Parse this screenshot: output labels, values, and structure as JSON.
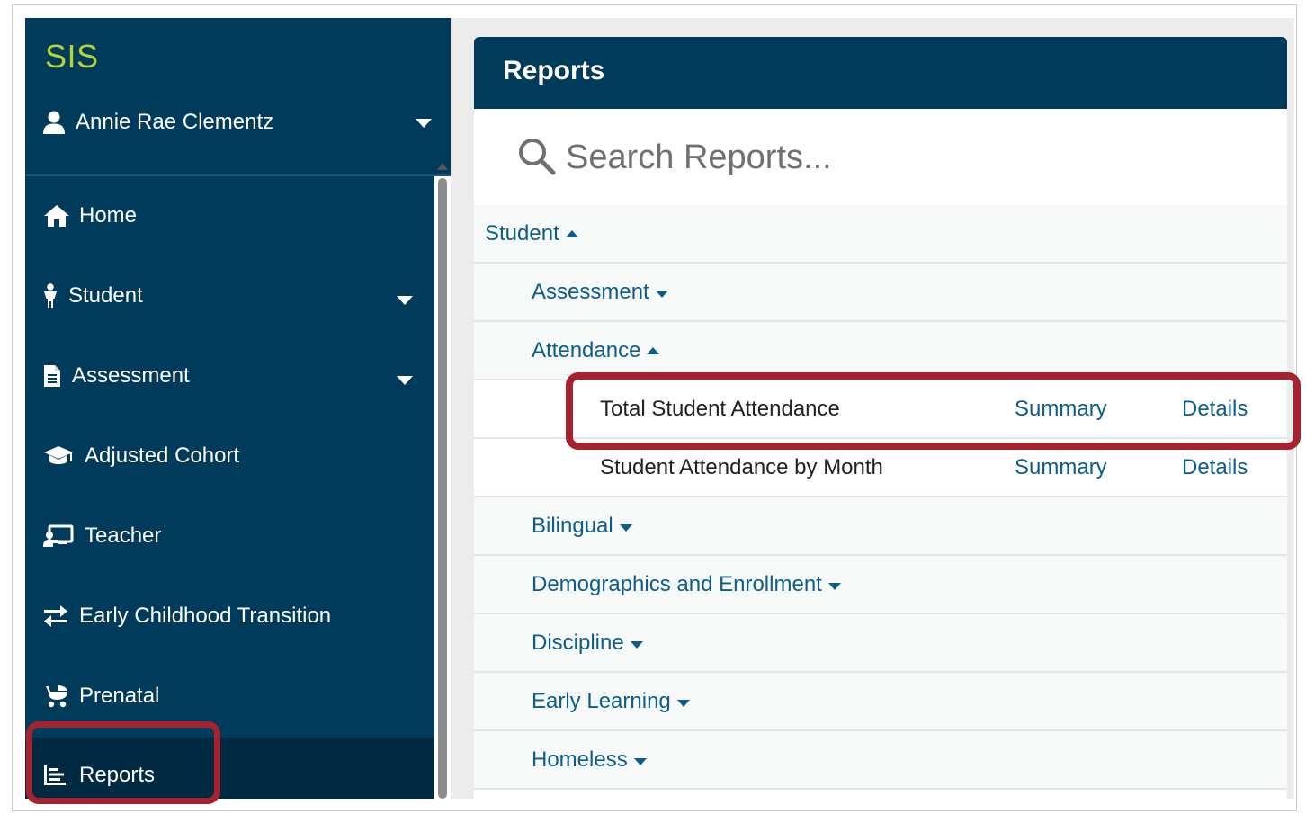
{
  "sidebar": {
    "brand": "SIS",
    "user": {
      "name": "Annie Rae Clementz",
      "icon": "user-icon"
    },
    "items": [
      {
        "label": "Home",
        "icon": "home-icon",
        "has_dropdown": false
      },
      {
        "label": "Student",
        "icon": "child-icon",
        "has_dropdown": true
      },
      {
        "label": "Assessment",
        "icon": "document-icon",
        "has_dropdown": true
      },
      {
        "label": "Adjusted Cohort",
        "icon": "graduation-cap-icon",
        "has_dropdown": false
      },
      {
        "label": "Teacher",
        "icon": "chalkboard-teacher-icon",
        "has_dropdown": false
      },
      {
        "label": "Early Childhood Transition",
        "icon": "exchange-arrows-icon",
        "has_dropdown": false
      },
      {
        "label": "Prenatal",
        "icon": "baby-carriage-icon",
        "has_dropdown": false
      },
      {
        "label": "Reports",
        "icon": "chart-bar-icon",
        "has_dropdown": false,
        "active": true
      }
    ]
  },
  "reports_panel": {
    "title": "Reports",
    "search": {
      "placeholder": "Search Reports...",
      "value": ""
    },
    "tree": {
      "category": {
        "label": "Student",
        "expanded": true
      },
      "groups": [
        {
          "label": "Assessment",
          "expanded": false
        },
        {
          "label": "Attendance",
          "expanded": true
        },
        {
          "label": "Bilingual",
          "expanded": false
        },
        {
          "label": "Demographics and Enrollment",
          "expanded": false
        },
        {
          "label": "Discipline",
          "expanded": false
        },
        {
          "label": "Early Learning",
          "expanded": false
        },
        {
          "label": "Homeless",
          "expanded": false
        }
      ],
      "attendance_reports": [
        {
          "name": "Total Student Attendance",
          "summary": "Summary",
          "details": "Details",
          "highlighted": true
        },
        {
          "name": "Student Attendance by Month",
          "summary": "Summary",
          "details": "Details",
          "highlighted": false
        }
      ]
    }
  },
  "colors": {
    "sidebar_bg": "#003b5c",
    "sidebar_active_bg": "#002a41",
    "brand": "#b4d334",
    "link": "#0c5d8a",
    "highlight_border": "#a4232f",
    "row_bg": "#f7f8f8"
  }
}
